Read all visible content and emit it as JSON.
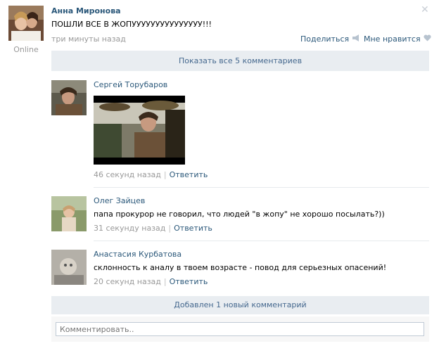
{
  "post": {
    "author_name": "Анна Миронова",
    "status": "Online",
    "text": "ПОШЛИ ВСЕ В ЖОПУУУУУУУУУУУУУУУ!!!",
    "time": "три минуты назад",
    "share_label": "Поделиться",
    "like_label": "Мне нравится"
  },
  "show_all_comments": "Показать все 5 комментариев",
  "comments": [
    {
      "author": "Сергей Торубаров",
      "text": "",
      "time": "46 секунд назад",
      "reply_label": "Ответить"
    },
    {
      "author": "Олег Зайцев",
      "text": "папа прокурор не говорил, что людей \"в жопу\" не хорошо посылать?))",
      "time": "31 секунду назад",
      "reply_label": "Ответить"
    },
    {
      "author": "Анастасия Курбатова",
      "text": "склонность к аналу в твоем возрасте - повод для серьезных опасений!",
      "time": "20 секунд назад",
      "reply_label": "Ответить"
    }
  ],
  "new_comment_notice": "Добавлен 1 новый комментарий",
  "comment_input": {
    "placeholder": "Комментировать..",
    "value": ""
  },
  "colors": {
    "link": "#2b587a",
    "bar_bg": "#e9edf1",
    "meta": "#999999"
  }
}
